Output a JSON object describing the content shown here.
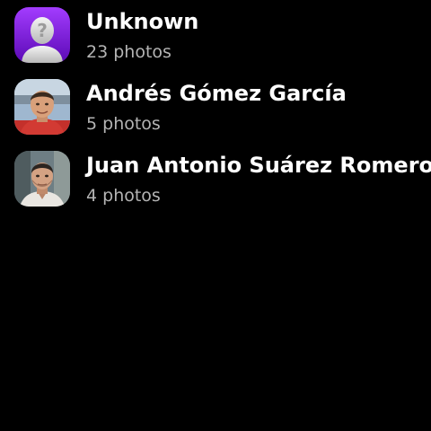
{
  "people": [
    {
      "name": "Unknown",
      "count": "23 photos",
      "avatar": "unknown-person-icon",
      "avatar_color": "#7a1fd6"
    },
    {
      "name": "Andrés Gómez García",
      "count": "5 photos",
      "avatar": "person-photo"
    },
    {
      "name": "Juan Antonio Suárez Romero",
      "count": "4 photos",
      "avatar": "person-photo"
    }
  ]
}
